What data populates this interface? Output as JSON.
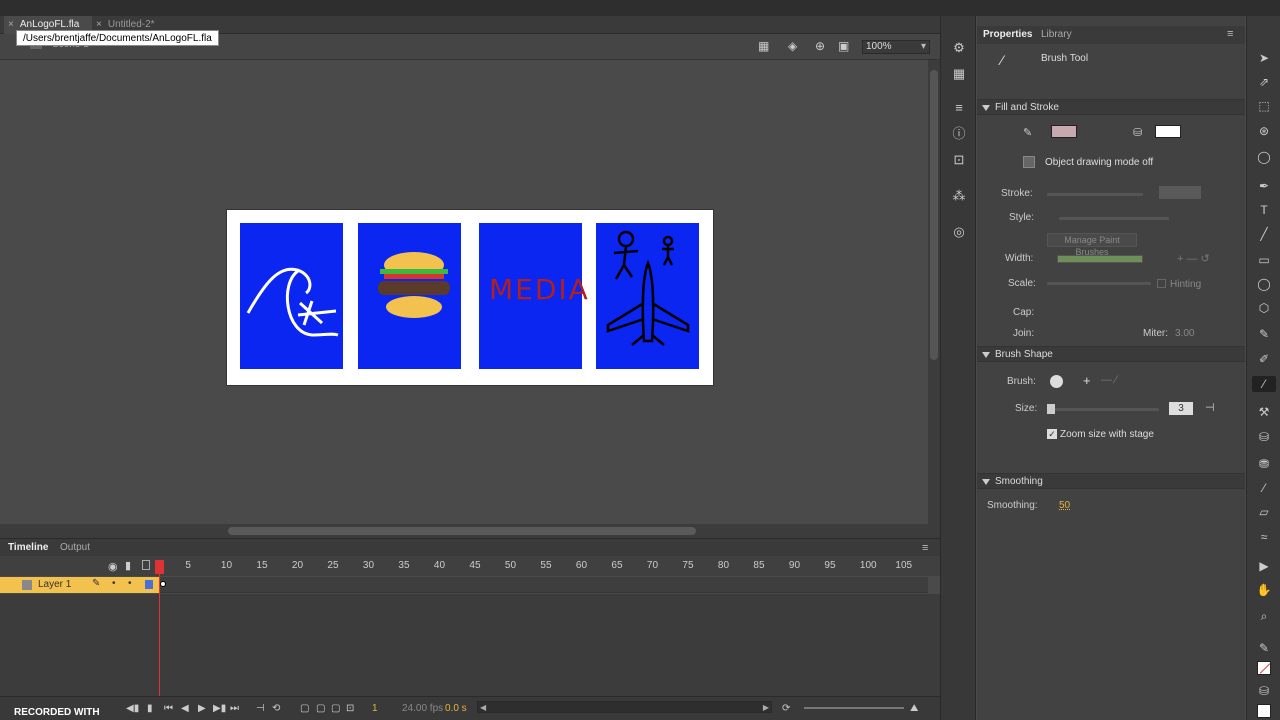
{
  "document_tabs": [
    {
      "label": "AnLogoFL.fla",
      "active": true
    },
    {
      "label": "Untitled-2*",
      "active": false
    }
  ],
  "tooltip": "/Users/brentjaffe/Documents/AnLogoFL.fla",
  "scene_label": "Scene 1",
  "zoom": "100%",
  "stage_panels": [
    {
      "name": "wave-drawing",
      "text": ""
    },
    {
      "name": "burger-drawing",
      "text": ""
    },
    {
      "name": "media-drawing",
      "text": "MEDIA"
    },
    {
      "name": "plane-drawing",
      "text": ""
    }
  ],
  "timeline": {
    "tabs": [
      "Timeline",
      "Output"
    ],
    "frame_numbers": [
      "1",
      "5",
      "10",
      "15",
      "20",
      "25",
      "30",
      "35",
      "40",
      "45",
      "50",
      "55",
      "60",
      "65",
      "70",
      "75",
      "80",
      "85",
      "90",
      "95",
      "100",
      "105"
    ],
    "layer_name": "Layer 1",
    "current_frame": "1",
    "fps": "24.00 fps",
    "time": "0.0 s"
  },
  "properties": {
    "tabs": [
      "Properties",
      "Library"
    ],
    "tool_name": "Brush Tool",
    "fill_stroke_header": "Fill and Stroke",
    "object_drawing": "Object drawing mode off",
    "stroke_label": "Stroke:",
    "style_label": "Style:",
    "manage_brushes": "Manage Paint Brushes",
    "width_label": "Width:",
    "scale_label": "Scale:",
    "hinting_label": "Hinting",
    "cap_label": "Cap:",
    "join_label": "Join:",
    "miter_label": "Miter:",
    "miter_value": "3.00",
    "brush_shape_header": "Brush Shape",
    "brush_label": "Brush:",
    "size_label": "Size:",
    "size_value": "3",
    "zoom_size_label": "Zoom size with stage",
    "smoothing_header": "Smoothing",
    "smoothing_label": "Smoothing:",
    "smoothing_value": "50",
    "fill_color": "#ffffff"
  },
  "recorded": "RECORDED WITH",
  "colors": {
    "stage_blue": "#0a26f0",
    "layer_highlight": "#f2c14e",
    "playhead": "#dd3333"
  }
}
